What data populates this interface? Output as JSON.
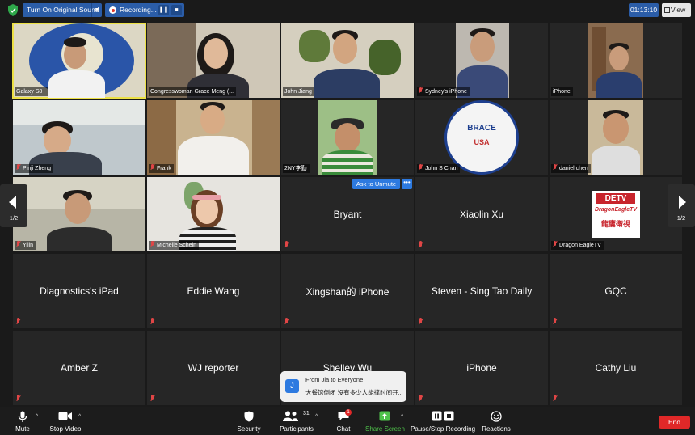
{
  "topbar": {
    "sound_label": "Turn On Original Sound",
    "recording_label": "Recording...",
    "timer": "01:13:10",
    "view_label": "View"
  },
  "tiles": [
    {
      "name": "Galaxy S8+"
    },
    {
      "name": "Congresswoman Grace Meng (..."
    },
    {
      "name": "John Jiang"
    },
    {
      "name": "Sydney's iPhone"
    },
    {
      "name": "iPhone"
    },
    {
      "name": "Pinji Zheng"
    },
    {
      "name": "Frank"
    },
    {
      "name": "2NY李勤"
    },
    {
      "name": "John S Chan"
    },
    {
      "name": "daniel chen"
    },
    {
      "name": "Yilin"
    },
    {
      "name": "Michelle Schein"
    },
    {
      "name": "Bryant"
    },
    {
      "name": "Xiaolin Xu"
    },
    {
      "name": "Dragon EagleTV"
    },
    {
      "name": "Diagnostics's iPad"
    },
    {
      "name": "Eddie Wang"
    },
    {
      "name": "Xingshan的 iPhone"
    },
    {
      "name": "Steven - Sing Tao Daily"
    },
    {
      "name": "GQC"
    },
    {
      "name": "Amber Z"
    },
    {
      "name": "WJ reporter"
    },
    {
      "name": "Shelley Wu"
    },
    {
      "name": "iPhone"
    },
    {
      "name": "Cathy Liu"
    }
  ],
  "ask_unmute_label": "Ask to Unmute",
  "more_label": "•••",
  "pager": {
    "left": "1/2",
    "right": "1/2"
  },
  "chat_toast": {
    "avatar": "J",
    "from": "From Jia to Everyone",
    "message": "大餐馆倒闭 没有多少人能撑时间开..."
  },
  "brace_logo": {
    "text": "BRACE",
    "sub": "USA"
  },
  "dragon_logo": {
    "top": "DETV",
    "sub": "DragonEagleTV",
    "cn": "龍鷹衛視"
  },
  "toolbar": {
    "mute": "Mute",
    "stop_video": "Stop Video",
    "security": "Security",
    "participants": "Participants",
    "participants_count": "31",
    "chat": "Chat",
    "chat_badge": "1",
    "share_screen": "Share Screen",
    "pause_recording": "Pause/Stop Recording",
    "reactions": "Reactions",
    "end": "End"
  },
  "colors": {
    "accent_blue": "#2b5da8",
    "share_green": "#4fc34b",
    "end_red": "#e02828",
    "active_speaker": "#ece045"
  }
}
